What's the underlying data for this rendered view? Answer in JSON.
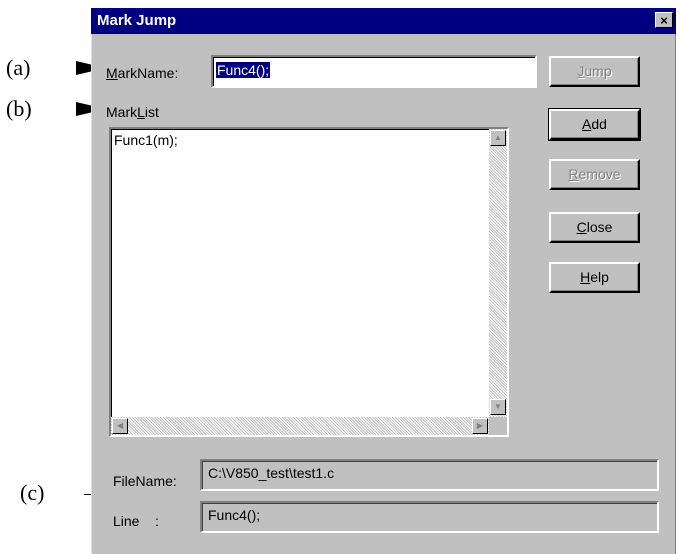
{
  "annotations": {
    "a": "(a)",
    "b": "(b)",
    "c": "(c)"
  },
  "dialog": {
    "title": "Mark Jump",
    "close_glyph": "×"
  },
  "markname": {
    "label_mnemonic": "M",
    "label_rest": "arkName:",
    "value": "Func4();"
  },
  "marklist": {
    "label_prefix": "Mark",
    "label_mnemonic": "L",
    "label_rest": "ist",
    "items": [
      "Func1(m);"
    ]
  },
  "buttons": {
    "jump": {
      "mnemonic": "J",
      "rest": "ump",
      "enabled": false
    },
    "add": {
      "mnemonic": "A",
      "rest": "dd",
      "enabled": true
    },
    "remove": {
      "mnemonic": "R",
      "rest": "emove",
      "enabled": false
    },
    "close": {
      "mnemonic": "C",
      "rest": "lose",
      "enabled": true
    },
    "help": {
      "mnemonic": "H",
      "rest": "elp",
      "enabled": true
    }
  },
  "info": {
    "filename_label": "FileName:",
    "filename_value": "C:\\V850_test\\test1.c",
    "line_label": "Line    :",
    "line_value": "Func4();"
  },
  "colors": {
    "titlebar": "#000080",
    "face": "#c0c0c0",
    "selection": "#000080"
  },
  "icons": {
    "close": "close-icon",
    "scroll_up": "arrow-up-icon",
    "scroll_down": "arrow-down-icon",
    "scroll_left": "arrow-left-icon",
    "scroll_right": "arrow-right-icon",
    "pointer": "pointer-arrow-icon"
  }
}
